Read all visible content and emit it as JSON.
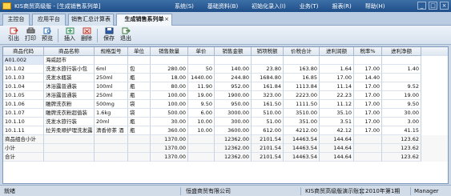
{
  "window": {
    "title": "KIS商贸高级版 - [生成销售系列单]",
    "menu": [
      "系统(S)",
      "基础资料(B)",
      "初始化录入(I)",
      "业务(T)",
      "报表(R)",
      "帮助(H)"
    ],
    "controls": [
      "_",
      "□",
      "×"
    ]
  },
  "tabs": [
    {
      "label": "主控台"
    },
    {
      "label": "应用平台"
    },
    {
      "label": "销售汇总计算表"
    },
    {
      "label": "生成销售系列单",
      "close": "×"
    }
  ],
  "toolbar": [
    {
      "label": "引出",
      "icon": "export-icon",
      "color": "#c0392b"
    },
    {
      "label": "打印",
      "icon": "print-icon",
      "color": "#555555"
    },
    {
      "label": "预览",
      "icon": "preview-icon",
      "color": "#2f6fb0"
    },
    {
      "label": "插入",
      "icon": "insert-icon",
      "color": "#2e8b57"
    },
    {
      "label": "删除",
      "icon": "delete-icon",
      "color": "#c0392b"
    },
    {
      "label": "保存",
      "icon": "save-icon",
      "color": "#2f5fa8"
    },
    {
      "label": "退出",
      "icon": "exit-icon",
      "color": "#3a7a3a"
    }
  ],
  "grid": {
    "columns": [
      "商品代码",
      "商品名称",
      "规格型号",
      "单位",
      "销售数量",
      "单价",
      "销售金额",
      "销项税额",
      "价税合计",
      "进利润额",
      "税率%",
      "进利净额"
    ],
    "rows": [
      [
        "A01.002",
        "海威超市",
        "",
        "",
        "",
        "",
        "",
        "",
        "",
        "",
        "",
        ""
      ],
      [
        "10.1.02",
        "洗发水旅行装小包",
        "6ml",
        "包",
        "280.00",
        "50",
        "140.00",
        "23.80",
        "163.80",
        "1.64",
        "17.00",
        "1.40"
      ],
      [
        "10.1.03",
        "洗发水瓶装",
        "250ml",
        "瓶",
        "18.00",
        "1440.00",
        "244.80",
        "1684.80",
        "16.85",
        "17.00",
        "14.40",
        ""
      ],
      [
        "10.1.04",
        "沐浴露普通装",
        "100ml",
        "瓶",
        "80.00",
        "11.90",
        "952.00",
        "161.84",
        "1113.84",
        "11.14",
        "17.00",
        "9.52"
      ],
      [
        "10.1.05",
        "沐浴露普通装",
        "250ml",
        "瓶",
        "100.00",
        "19.00",
        "1900.00",
        "323.00",
        "2223.00",
        "22.23",
        "17.00",
        "19.00"
      ],
      [
        "10.1.06",
        "雕牌洗衣粉",
        "500mg",
        "袋",
        "100.00",
        "9.50",
        "950.00",
        "161.50",
        "1111.50",
        "11.12",
        "17.00",
        "9.50"
      ],
      [
        "10.1.07",
        "雕牌洗衣粉超值装",
        "1.6kg",
        "袋",
        "500.00",
        "6.00",
        "3000.00",
        "510.00",
        "3510.00",
        "35.10",
        "17.00",
        "30.00"
      ],
      [
        "10.1.10",
        "洗发水旅行装",
        "20ml",
        "瓶",
        "30.00",
        "10.00",
        "300.00",
        "51.00",
        "351.00",
        "3.51",
        "17.00",
        "3.00"
      ],
      [
        "10.1.11",
        "拉芳柔顺护理洗发露",
        "清香修茶 酒",
        "瓶",
        "360.00",
        "10.00",
        "3600.00",
        "612.00",
        "4212.00",
        "42.12",
        "17.00",
        "41.15"
      ],
      [
        "商品组合小计",
        "",
        "",
        "",
        "1370.00",
        "",
        "12362.00",
        "2101.54",
        "14463.54",
        "144.64",
        "",
        "123.62"
      ],
      [
        "小计",
        "",
        "",
        "",
        "1370.00",
        "",
        "12362.00",
        "2101.54",
        "14463.54",
        "144.64",
        "",
        "123.62"
      ],
      [
        "合计",
        "",
        "",
        "",
        "1370.00",
        "",
        "12362.00",
        "2101.54",
        "14463.54",
        "144.64",
        "",
        "123.62"
      ]
    ]
  },
  "status": {
    "left": "就绪",
    "company": "恒盛商贸有限公司",
    "account": "KIS商贸高级版演示账套",
    "period": "2010年第1期",
    "user": "Manager"
  }
}
